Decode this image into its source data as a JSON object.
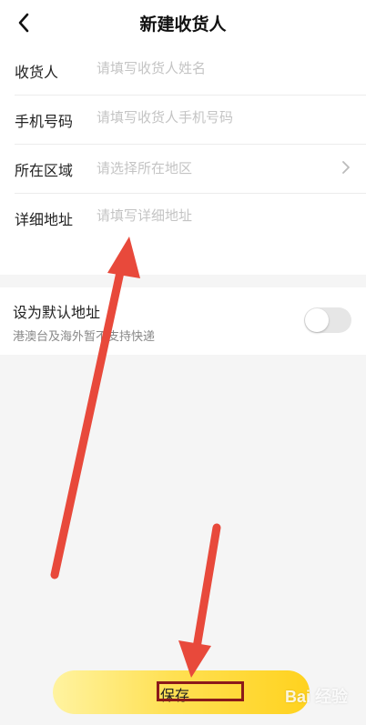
{
  "header": {
    "title": "新建收货人",
    "back_icon": "chevron-left-icon"
  },
  "form": {
    "name": {
      "label": "收货人",
      "placeholder": "请填写收货人姓名",
      "value": ""
    },
    "phone": {
      "label": "手机号码",
      "placeholder": "请填写收货人手机号码",
      "value": ""
    },
    "region": {
      "label": "所在区域",
      "placeholder": "请选择所在地区",
      "chevron_icon": "chevron-right-icon"
    },
    "detail": {
      "label": "详细地址",
      "placeholder": "请填写详细地址",
      "value": ""
    }
  },
  "default_address": {
    "title": "设为默认地址",
    "subtitle": "港澳台及海外暂不支持快递",
    "enabled": false
  },
  "footer": {
    "save_label": "保存"
  },
  "annotations": {
    "arrow_color": "#e8493b",
    "box_color": "#8b1a1a"
  },
  "watermark": {
    "text": "Bai 经验"
  },
  "colors": {
    "accent_start": "#fff3a0",
    "accent_end": "#ffd21e",
    "placeholder": "#c4c4c4",
    "background": "#f5f5f5"
  }
}
